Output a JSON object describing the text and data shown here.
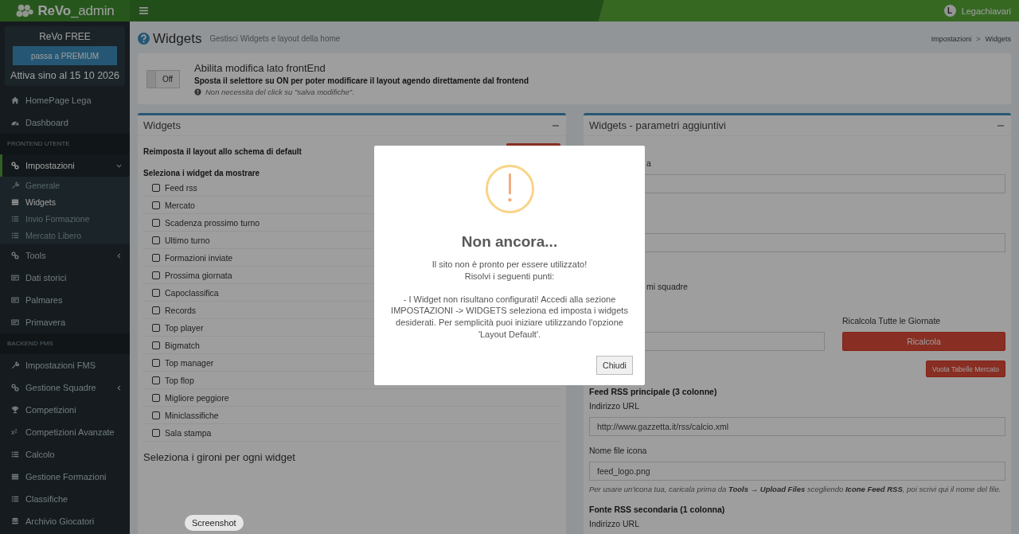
{
  "header": {
    "logo": "**ReVo**_admin",
    "user": {
      "initial": "L",
      "name": "Legachiavari"
    }
  },
  "sidebar": {
    "plan": {
      "title": "ReVo FREE",
      "button": "passa a PREMIUM",
      "expiry": "Attiva sino al 15 10 2026"
    },
    "menu": [
      {
        "kind": "item",
        "label": "HomePage Lega",
        "selected": false
      },
      {
        "kind": "item",
        "label": "Dashboard",
        "selected": false
      },
      {
        "kind": "header",
        "label": "FRONTEND UTENTE"
      },
      {
        "kind": "item",
        "label": "Impostazioni",
        "selected": true,
        "expanded": true,
        "children": [
          {
            "label": "Generale",
            "selected": false
          },
          {
            "label": "Widgets",
            "selected": true
          },
          {
            "label": "Invio Formazione",
            "selected": false
          },
          {
            "label": "Mercato Libero",
            "selected": false
          }
        ]
      },
      {
        "kind": "item",
        "label": "Tools",
        "selected": false,
        "expanded": false
      },
      {
        "kind": "item",
        "label": "Dati storici",
        "selected": false
      },
      {
        "kind": "item",
        "label": "Palmares",
        "selected": false
      },
      {
        "kind": "item",
        "label": "Primavera",
        "selected": false
      },
      {
        "kind": "header",
        "label": "BACKEND FMS"
      },
      {
        "kind": "item",
        "label": "Impostazioni FMS",
        "selected": false
      },
      {
        "kind": "item",
        "label": "Gestione Squadre",
        "selected": false,
        "expanded": false
      },
      {
        "kind": "item",
        "label": "Competizioni",
        "selected": false
      },
      {
        "kind": "item",
        "label": "Competizioni Avanzate",
        "selected": false,
        "icon_text": "x²"
      },
      {
        "kind": "item",
        "label": "Calcolo",
        "selected": false
      },
      {
        "kind": "item",
        "label": "Gestione Formazioni",
        "selected": false
      },
      {
        "kind": "item",
        "label": "Classifiche",
        "selected": false
      },
      {
        "kind": "item",
        "label": "Archivio Giocatori",
        "selected": false
      }
    ]
  },
  "page": {
    "title": "Widgets",
    "subtitle": "Gestisci Widgets e layout della home",
    "breadcrumb": [
      "Impostazioni",
      "Widgets"
    ],
    "breadcrumb_separator": ">"
  },
  "frontend_edit": {
    "toggle": {
      "label": "Off",
      "on": false
    },
    "title": "Abilita modifica lato frontEnd",
    "instruction": "Sposta il selettore su ON per poter modificare il layout agendo direttamente dal frontend",
    "note": "Non necessita del click su \"salva modifiche\"."
  },
  "widgets_panel": {
    "title": "Widgets",
    "reset_label": "Reimposta il layout allo schema di default",
    "select_label": "Seleziona i widget da mostrare",
    "widgets": [
      {
        "label": "Feed rss",
        "checked": false
      },
      {
        "label": "Mercato",
        "checked": false
      },
      {
        "label": "Scadenza prossimo turno",
        "checked": false
      },
      {
        "label": "Ultimo turno",
        "checked": false
      },
      {
        "label": "Formazioni inviate",
        "checked": false
      },
      {
        "label": "Prossima giornata",
        "checked": false
      },
      {
        "label": "Capoclassifica",
        "checked": false
      },
      {
        "label": "Records",
        "checked": false
      },
      {
        "label": "Top player",
        "checked": false
      },
      {
        "label": "Bigmatch",
        "checked": false
      },
      {
        "label": "Top manager",
        "checked": false
      },
      {
        "label": "Top flop",
        "checked": false
      },
      {
        "label": "Migliore peggiore",
        "checked": false
      },
      {
        "label": "Miniclassifiche",
        "checked": false
      },
      {
        "label": "Sala stampa",
        "checked": false
      }
    ],
    "groups_title": "Seleziona i gironi per ogni widget"
  },
  "params_panel": {
    "title": "Widgets - parametri aggiuntivi",
    "items": [
      {
        "kind": "peek",
        "text": "a"
      },
      {
        "kind": "field"
      },
      {
        "kind": "field"
      },
      {
        "kind": "peek",
        "text": "mi squadre"
      },
      {
        "kind": "recalc",
        "label": "Ricalcola Tutte le Giornate",
        "button": "Ricalcola"
      },
      {
        "kind": "danger_button",
        "text": "Vuota Tabelle Mercato"
      },
      {
        "kind": "heading",
        "text": "Feed RSS principale (3 colonne)"
      },
      {
        "kind": "label",
        "text": "Indirizzo URL"
      },
      {
        "kind": "field",
        "value": "http://www.gazzetta.it/rss/calcio.xml"
      },
      {
        "kind": "label",
        "text": "Nome file icona"
      },
      {
        "kind": "field",
        "value": "feed_logo.png"
      },
      {
        "kind": "help",
        "parts": [
          {
            "text": "Per usare un'icona tua, caricala prima da ",
            "bold": false
          },
          {
            "text": "Tools → Upload Files",
            "bold": true
          },
          {
            "text": " scegliendo ",
            "bold": false
          },
          {
            "text": "Icone Feed RSS",
            "bold": true
          },
          {
            "text": ", poi scrivi qui il nome del file.",
            "bold": false
          }
        ]
      },
      {
        "kind": "heading",
        "text": "Fonte RSS secondaria (1 colonna)"
      },
      {
        "kind": "label",
        "text": "Indirizzo URL"
      }
    ]
  },
  "modal": {
    "title": "Non ancora...",
    "message": [
      "Il sito non è pronto per essere utilizzato!",
      "Risolvi i seguenti punti:"
    ],
    "points": [
      "- I Widget non risultano configurati! Accedi alla sezione IMPOSTAZIONI -> WIDGETS seleziona ed imposta i widgets desiderati. Per semplicità puoi iniziare utilizzando l'opzione 'Layout Default'."
    ],
    "button": "Chiudi"
  },
  "tooltip": "Screenshot"
}
